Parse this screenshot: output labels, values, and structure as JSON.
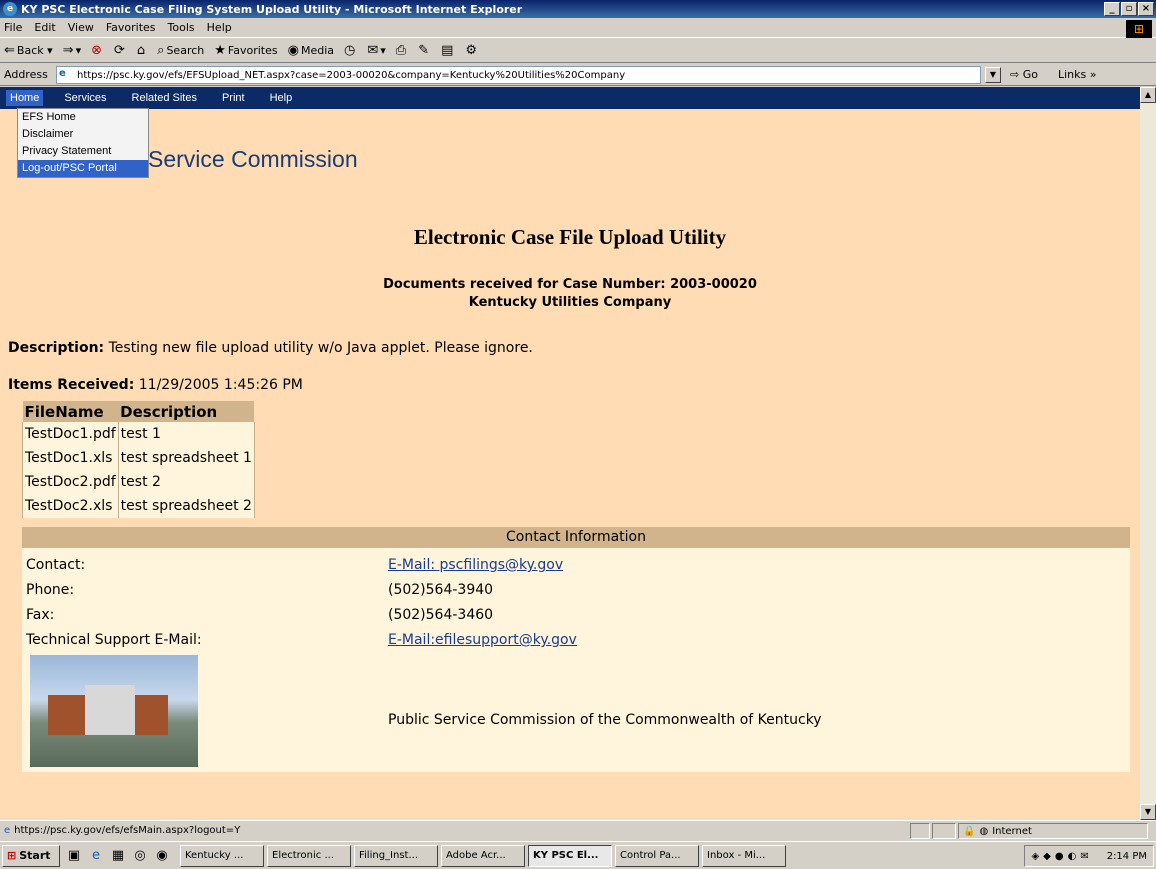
{
  "window": {
    "title": "KY PSC Electronic Case Filing System Upload Utility - Microsoft Internet Explorer"
  },
  "menu": [
    "File",
    "Edit",
    "View",
    "Favorites",
    "Tools",
    "Help"
  ],
  "toolbar": {
    "back": "Back",
    "search": "Search",
    "favorites": "Favorites",
    "media": "Media"
  },
  "address": {
    "label": "Address",
    "url": "https://psc.ky.gov/efs/EFSUpload_NET.aspx?case=2003-00020&company=Kentucky%20Utilities%20Company",
    "go": "Go",
    "links": "Links"
  },
  "nav": [
    "Home",
    "Services",
    "Related Sites",
    "Print",
    "Help"
  ],
  "dropdown": [
    "EFS Home",
    "Disclaimer",
    "Privacy Statement",
    "Log-out/PSC Portal"
  ],
  "site_title": "Service Commission",
  "heading": "Electronic Case File Upload Utility",
  "case_line": "Documents received for Case Number: 2003-00020",
  "company": "Kentucky Utilities Company",
  "description": {
    "label": "Description:",
    "text": "Testing new file upload utility w/o Java applet. Please ignore."
  },
  "items_received": {
    "label": "Items Received:",
    "text": "11/29/2005 1:45:26 PM"
  },
  "files": {
    "headers": [
      "FileName",
      "Description"
    ],
    "rows": [
      [
        "TestDoc1.pdf",
        "test 1"
      ],
      [
        "TestDoc1.xls",
        "test spreadsheet 1"
      ],
      [
        "TestDoc2.pdf",
        "test 2"
      ],
      [
        "TestDoc2.xls",
        "test spreadsheet 2"
      ]
    ]
  },
  "contact": {
    "header": "Contact Information",
    "contact_label": "Contact:",
    "contact_value": "E-Mail: pscfilings@ky.gov",
    "phone_label": "Phone:",
    "phone_value": "(502)564-3940",
    "fax_label": "Fax:",
    "fax_value": "(502)564-3460",
    "tech_label": "Technical Support E-Mail:",
    "tech_value": "E-Mail:efilesupport@ky.gov",
    "footer": "Public Service Commission of the Commonwealth of Kentucky"
  },
  "status": {
    "url": "https://psc.ky.gov/efs/efsMain.aspx?logout=Y",
    "zone": "Internet"
  },
  "taskbar": {
    "start": "Start",
    "tasks": [
      "Kentucky ...",
      "Electronic ...",
      "Filing_Inst...",
      "Adobe Acr...",
      "KY PSC El...",
      "Control Pa...",
      "Inbox - Mi..."
    ],
    "clock": "2:14 PM"
  }
}
